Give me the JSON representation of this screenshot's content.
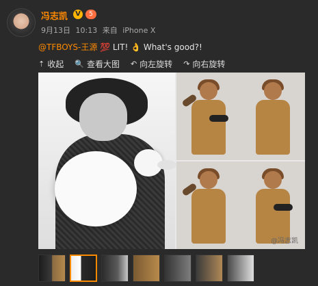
{
  "post": {
    "username": "冯志凯",
    "v_badge": "V",
    "level_badge": "5",
    "meta": {
      "date": "9月13日",
      "time": "10:13",
      "source_prefix": "来自",
      "source": "iPhone X"
    },
    "content": {
      "mention": "@TFBOYS-王源",
      "text": " 💯 LIT! 👌 What's good?!"
    }
  },
  "toolbar": {
    "items": [
      {
        "icon": "collapse-icon",
        "label": "收起"
      },
      {
        "icon": "zoom-icon",
        "label": "查看大图"
      },
      {
        "icon": "rotate-left-icon",
        "label": "向左旋转"
      },
      {
        "icon": "rotate-right-icon",
        "label": "向右旋转"
      }
    ]
  },
  "media": {
    "watermark": "@冯志凯"
  },
  "thumbnails": {
    "count": 7,
    "active_index": 1
  },
  "colors": {
    "background": "#2a2a2a",
    "accent_orange": "#ff8a00",
    "text_light": "#e5e5e5",
    "text_muted": "#aaaaaa"
  }
}
